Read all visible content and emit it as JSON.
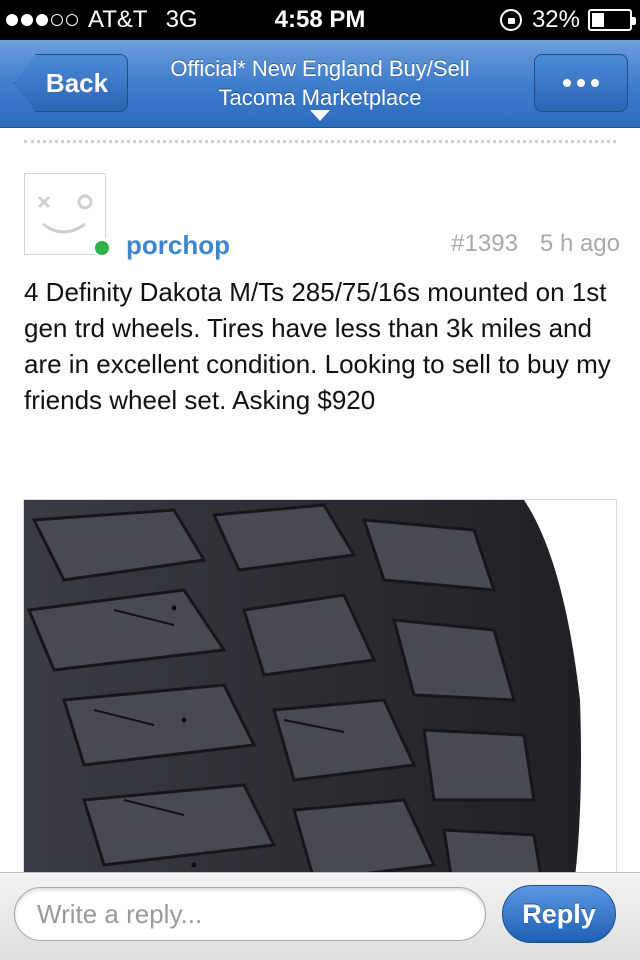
{
  "status_bar": {
    "carrier": "AT&T",
    "network": "3G",
    "signal_bars_filled": 3,
    "signal_bars_total": 5,
    "time": "4:58 PM",
    "battery_text": "32%",
    "battery_level": 0.32
  },
  "nav": {
    "back_label": "Back",
    "title_line1": "Official* New England Buy/Sell",
    "title_line2": "Tacoma Marketplace",
    "more_icon": "ellipsis-icon"
  },
  "post": {
    "username": "porchop",
    "number": "#1393",
    "age": "5 h ago",
    "online": true,
    "body": "4 Definity Dakota M/Ts 285/75/16s mounted on 1st gen trd wheels. Tires have less than 3k miles and are in excellent condition. Looking to sell to buy my friends wheel set. Asking $920"
  },
  "reply": {
    "placeholder": "Write a reply...",
    "value": "",
    "button_label": "Reply"
  },
  "colors": {
    "nav_blue": "#3f7ccc",
    "username_blue": "#3f85cc",
    "online_green": "#2fb14a",
    "meta_gray": "#a9a9a9"
  }
}
